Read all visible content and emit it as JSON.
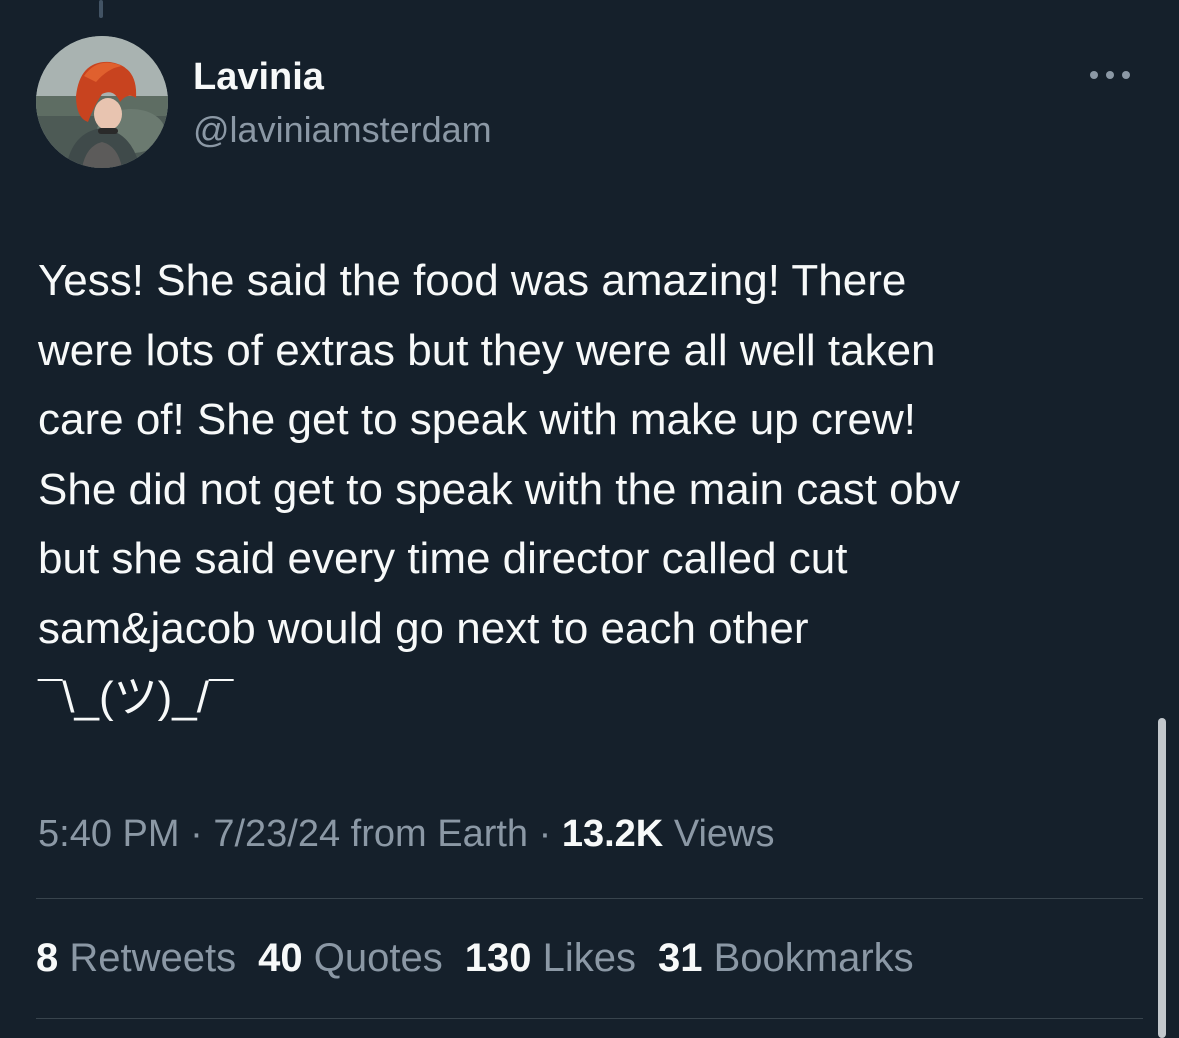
{
  "tweet": {
    "author": {
      "display_name": "Lavinia",
      "handle": "@laviniamsterdam"
    },
    "text_lines": [
      "Yess! She said the food was amazing! There",
      "were lots of extras but they were all well taken",
      "care of! She get to speak with make up crew!",
      "She did not get to speak with the main cast obv",
      "but she said every time director called cut",
      "sam&jacob would go next to each other",
      "¯\\_(ツ)_/¯"
    ],
    "meta": {
      "time": "5:40 PM",
      "separator": " · ",
      "date": "7/23/24",
      "source": "from Earth",
      "views_count": "13.2K",
      "views_label": "Views"
    },
    "stats": [
      {
        "count": "8",
        "label": "Retweets"
      },
      {
        "count": "40",
        "label": "Quotes"
      },
      {
        "count": "130",
        "label": "Likes"
      },
      {
        "count": "31",
        "label": "Bookmarks"
      }
    ]
  },
  "icons": {
    "more": "more-horizontal-icon"
  },
  "colors": {
    "background": "#15202b",
    "primary_text": "#f7f9f9",
    "secondary_text": "#8b98a5",
    "divider": "#38444d",
    "avatar_hair": "#c8431f"
  }
}
